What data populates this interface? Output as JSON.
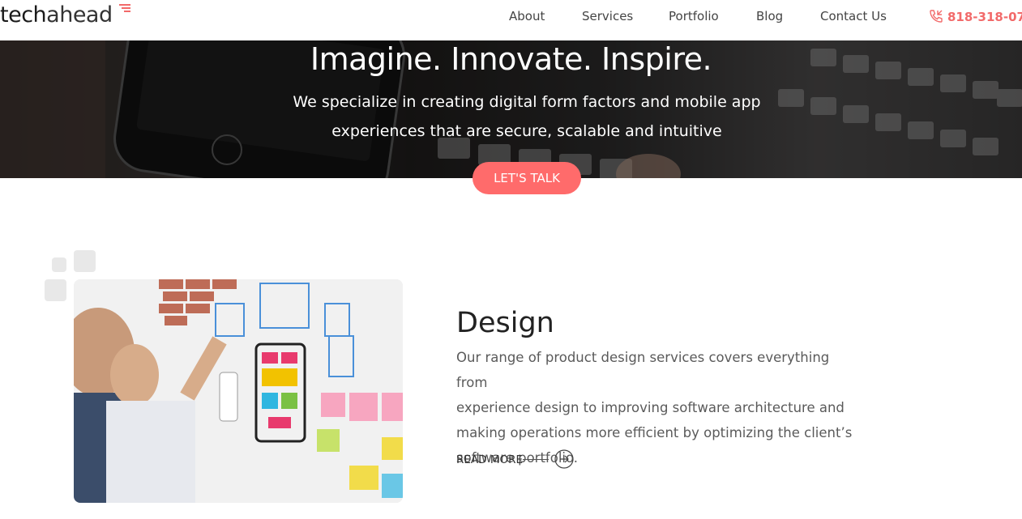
{
  "header": {
    "logo_part1": "tech",
    "logo_part2": "ahead",
    "nav": [
      {
        "label": "About"
      },
      {
        "label": "Services"
      },
      {
        "label": "Portfolio"
      },
      {
        "label": "Blog"
      },
      {
        "label": "Contact Us"
      }
    ],
    "phone": "818-318-07",
    "phone_icon": "phone-icon",
    "accent_color": "#f26a6a"
  },
  "hero": {
    "title": "Imagine. Innovate. Inspire.",
    "subtitle_line1": "We specialize in creating digital form factors and mobile app",
    "subtitle_line2": "experiences that are secure, scalable and intuitive",
    "cta_label": "LET'S TALK",
    "cta_color": "#ff6b6b"
  },
  "design": {
    "title": "Design",
    "body_line1": "Our range of product design services covers everything from",
    "body_line2": "experience design to improving software architecture and",
    "body_line3": "making operations more efficient by optimizing the client’s",
    "body_line4": "software portfolio.",
    "read_more": "READ MORE",
    "arrow_icon": "arrow-right-circle-icon"
  }
}
